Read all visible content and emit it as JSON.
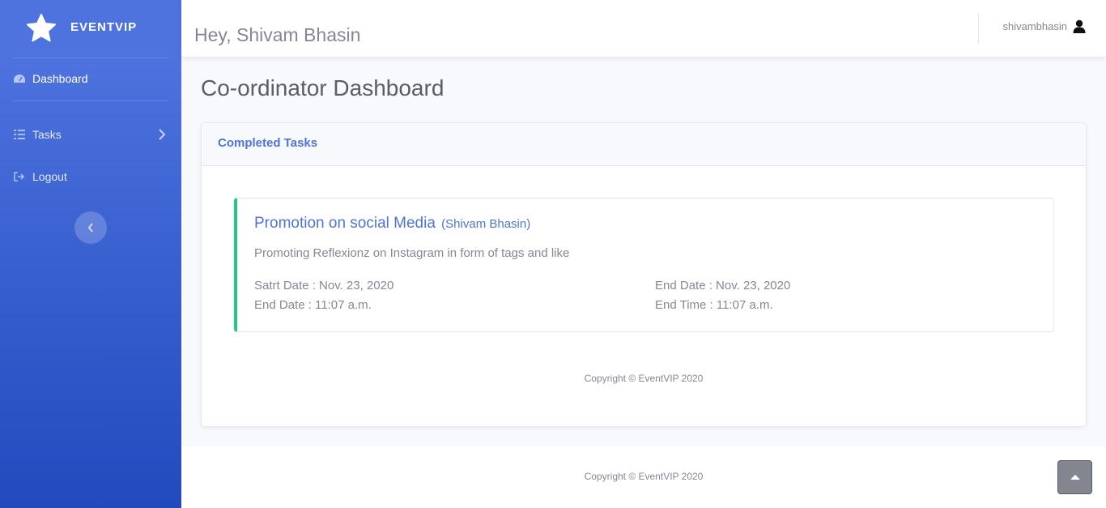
{
  "brand": {
    "name": "EVENTVIP",
    "icon": "star-icon"
  },
  "sidebar": {
    "items": [
      {
        "label": "Dashboard",
        "icon": "tachometer-icon",
        "active": true
      },
      {
        "label": "Tasks",
        "icon": "tasks-icon",
        "has_submenu": true
      },
      {
        "label": "Logout",
        "icon": "sign-out-icon"
      }
    ],
    "toggle_icon": "chevron-left-icon"
  },
  "topbar": {
    "greeting": "Hey, Shivam Bhasin",
    "username": "shivambhasin",
    "user_icon": "user-icon"
  },
  "page": {
    "title": "Co-ordinator Dashboard"
  },
  "card": {
    "header": "Completed Tasks",
    "task": {
      "title": "Promotion on social Media",
      "owner": "(Shivam Bhasin)",
      "description": "Promoting Reflexionz on Instagram in form of tags and like",
      "start_date": "Satrt Date : Nov. 23, 2020",
      "end_time_left": "End Date : 11:07 a.m.",
      "end_date": "End Date : Nov. 23, 2020",
      "end_time": "End Time : 11:07 a.m.",
      "accent_color": "#1cc88a"
    },
    "copyright": "Copyright © EventVIP 2020"
  },
  "footer": {
    "copyright": "Copyright © EventVIP 2020"
  },
  "scroll_top_icon": "chevron-up-icon",
  "colors": {
    "primary": "#4e73df",
    "success": "#1cc88a",
    "sidebar_bottom": "#224abe"
  }
}
